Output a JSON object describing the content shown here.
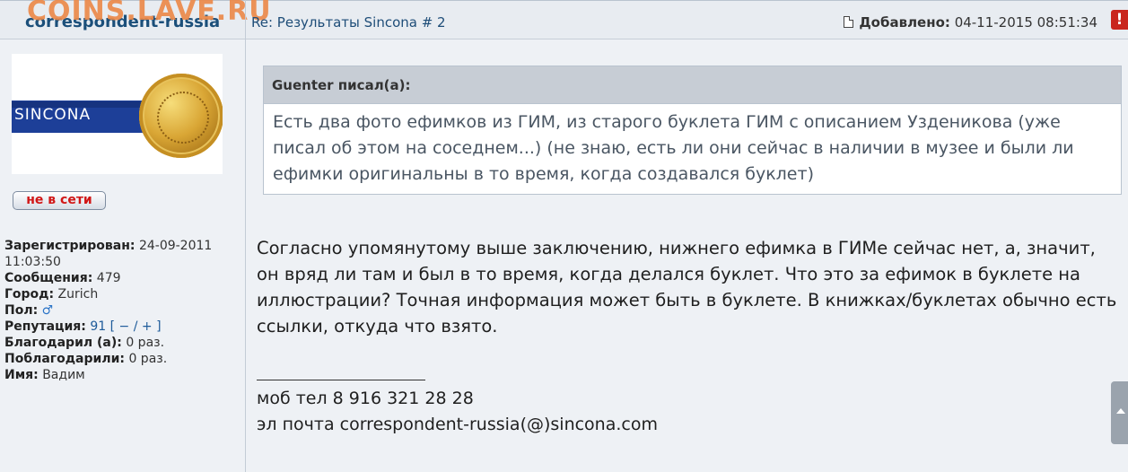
{
  "watermark": "COINS.LAVE.RU",
  "header": {
    "author": "correspondent-russia",
    "subject": "Re: Результаты Sincona # 2",
    "added_label": "Добавлено:",
    "added_date": "04-11-2015 08:51:34",
    "report_icon": "!"
  },
  "avatar": {
    "brand": "SINCONA"
  },
  "status": "не в сети",
  "profile": {
    "registered_label": "Зарегистрирован:",
    "registered_value": "24-09-2011 11:03:50",
    "messages_label": "Сообщения:",
    "messages_value": "479",
    "city_label": "Город:",
    "city_value": "Zurich",
    "gender_label": "Пол:",
    "gender_icon": "♂",
    "reputation_label": "Репутация:",
    "reputation_value": "91",
    "reputation_open": "[",
    "reputation_minus": "−",
    "reputation_sep": "/",
    "reputation_plus": "+",
    "reputation_close": "]",
    "thanked_label": "Благодарил (а):",
    "thanked_value": "0 раз.",
    "was_thanked_label": "Поблагодарили:",
    "was_thanked_value": "0 раз.",
    "name_label": "Имя:",
    "name_value": "Вадим"
  },
  "quote": {
    "header": "Guenter писал(а):",
    "text": "Есть два фото ефимков из ГИМ, из старого буклета ГИМ с описанием Узденикова (уже писал об этом на соседнем...) (не знаю, есть ли они сейчас в наличии в музее и были ли ефимки оригинальны в то время, когда создавался буклет)"
  },
  "post": {
    "text": "Согласно упомянутому выше заключению, нижнего ефимка в ГИМе сейчас нет, а, значит, он вряд ли там и был в то время, когда делался буклет. Что это за ефимок в буклете на иллюстрации? Точная информация может быть в буклете. В книжках/буклетах обычно есть ссылки, откуда что взято."
  },
  "signature": {
    "phone": "моб тел 8 916 321 28 28",
    "email": "эл почта correspondent-russia(@)sincona.com"
  }
}
